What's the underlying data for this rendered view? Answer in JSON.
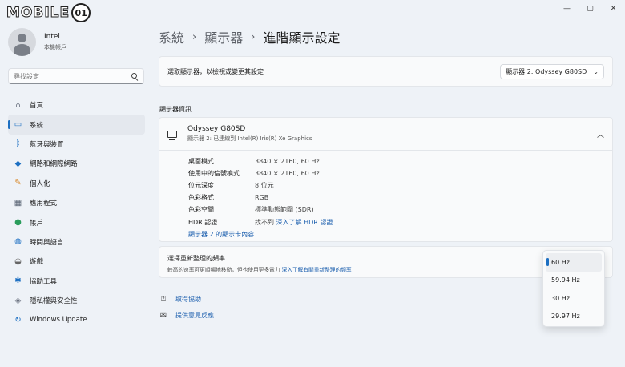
{
  "logo": {
    "text": "MOBILE",
    "suffix": "01"
  },
  "window": {
    "minimize": "—",
    "maximize": "▢",
    "close": "✕"
  },
  "user": {
    "name": "Intel",
    "account": "本機帳戶"
  },
  "search": {
    "placeholder": "尋找設定"
  },
  "nav": [
    {
      "label": "首頁",
      "icon": "home-icon",
      "glyph": "⌂"
    },
    {
      "label": "系統",
      "icon": "system-icon",
      "glyph": "▭",
      "active": true
    },
    {
      "label": "藍牙與裝置",
      "icon": "bluetooth-icon",
      "glyph": "ᛒ"
    },
    {
      "label": "網路和網際網路",
      "icon": "wifi-icon",
      "glyph": "◆"
    },
    {
      "label": "個人化",
      "icon": "brush-icon",
      "glyph": "✎"
    },
    {
      "label": "應用程式",
      "icon": "apps-icon",
      "glyph": "▦"
    },
    {
      "label": "帳戶",
      "icon": "account-icon",
      "glyph": "●"
    },
    {
      "label": "時間與語言",
      "icon": "globe-icon",
      "glyph": "◍"
    },
    {
      "label": "遊戲",
      "icon": "gamepad-icon",
      "glyph": "◒"
    },
    {
      "label": "協助工具",
      "icon": "accessibility-icon",
      "glyph": "✱"
    },
    {
      "label": "隱私權與安全性",
      "icon": "shield-icon",
      "glyph": "◈"
    },
    {
      "label": "Windows Update",
      "icon": "update-icon",
      "glyph": "↻"
    }
  ],
  "breadcrumb": {
    "part1": "系統",
    "part2": "顯示器",
    "current": "進階顯示設定",
    "sep": "›"
  },
  "select_display": {
    "label": "選取顯示器，以檢視或變更其設定",
    "value": "顯示器 2: Odyssey G80SD",
    "chevron": "⌄"
  },
  "section_label": "顯示器資訊",
  "display": {
    "name": "Odyssey G80SD",
    "subtitle": "顯示器 2: 已連線到 Intel(R) Iris(R) Xe Graphics",
    "chevron": "︿",
    "rows": [
      {
        "key": "桌面模式",
        "value": "3840 × 2160, 60 Hz"
      },
      {
        "key": "使用中的信號模式",
        "value": "3840 × 2160, 60 Hz"
      },
      {
        "key": "位元深度",
        "value": "8 位元"
      },
      {
        "key": "色彩格式",
        "value": "RGB"
      },
      {
        "key": "色彩空間",
        "value": "標準動態範圍 (SDR)"
      }
    ],
    "hdr_key": "HDR 認證",
    "hdr_value": "找不到",
    "hdr_link": "深入了解 HDR 認證",
    "adapter_link": "顯示器 2 的顯示卡內容"
  },
  "refresh": {
    "title": "選擇重新整理的頻率",
    "subtitle": "較高的速率可更順暢地移動，但也使用更多電力",
    "link": "深入了解有關重新整理的頻率"
  },
  "help": {
    "get_help": "取得協助",
    "feedback": "提供意見反應"
  },
  "refresh_options": [
    "60 Hz",
    "59.94 Hz",
    "30 Hz",
    "29.97 Hz"
  ],
  "refresh_selected": "60 Hz",
  "colors": {
    "accent": "#1c6fc2",
    "link": "#1c5fae",
    "background": "#eef2f7"
  }
}
